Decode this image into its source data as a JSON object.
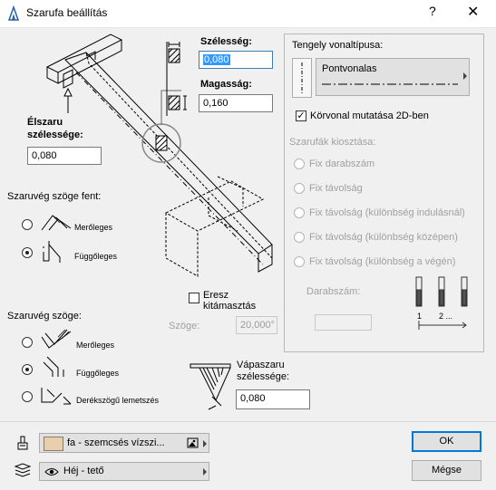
{
  "window": {
    "title": "Szarufa beállítás",
    "help": "?",
    "close": "✕"
  },
  "left": {
    "szelesseg_label": "Szélesség:",
    "szelesseg_value": "0,080",
    "magassag_label": "Magasság:",
    "magassag_value": "0,160",
    "elszaru_label_1": "Élszaru",
    "elszaru_label_2": "szélessége:",
    "elszaru_value": "0,080",
    "szaruveg_fent_label": "Szaruvég szöge fent:",
    "fent_options": [
      "Merőleges",
      "Függőleges"
    ],
    "szaruveg_label": "Szaruvég szöge:",
    "veg_options": [
      "Merőleges",
      "Függőleges",
      "Derékszögű lemetszés"
    ],
    "eresz_label_1": "Eresz",
    "eresz_label_2": "kitámasztás",
    "szoge_label": "Szöge:",
    "szoge_value": "20,000°",
    "vapaszaru_label_1": "Vápaszaru",
    "vapaszaru_label_2": "szélessége:",
    "vapaszaru_value": "0,080"
  },
  "right": {
    "tengely_label": "Tengely vonaltípusa:",
    "linetype_name": "Pontvonalas",
    "korvonal_label": "Körvonal mutatása 2D-ben",
    "kiosztas_label": "Szarufák kiosztása:",
    "kiosztas_options": [
      "Fix darabszám",
      "Fix távolság",
      "Fix távolság (különbség indulásnál)",
      "Fix távolság (különbség középen)",
      "Fix távolság (különbség a végén)"
    ],
    "darabszam_label": "Darabszám:",
    "darabszam_value": "",
    "dist_labels": [
      "1",
      "2 ..."
    ]
  },
  "bottom": {
    "material": "fa - szemcsés vízszi...",
    "layer": "Héj - tető",
    "ok": "OK",
    "cancel": "Mégse"
  },
  "colors": {
    "material_swatch": "#e8cfae",
    "selection": "#3399ff",
    "focus_border": "#3c7fb1"
  }
}
